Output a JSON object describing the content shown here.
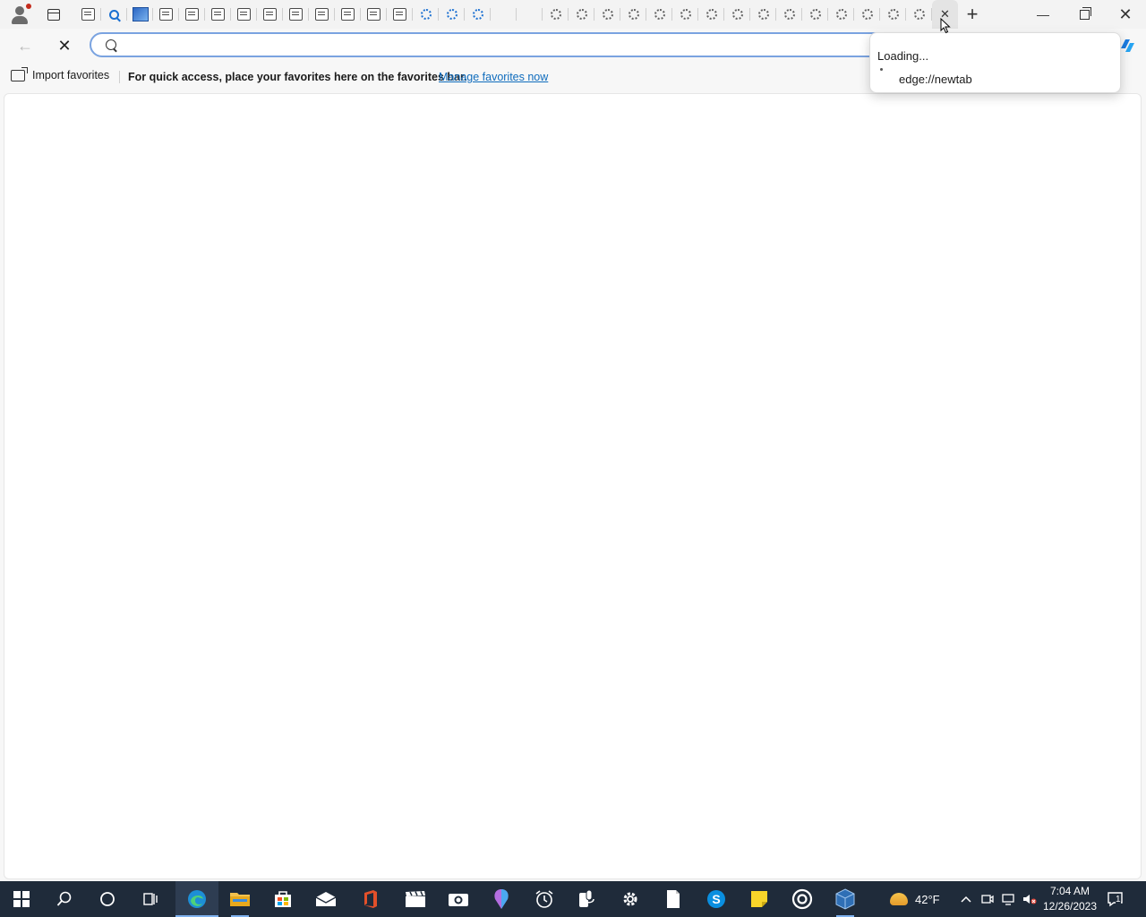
{
  "tabs": {
    "count_visible": 34,
    "active_close_glyph": "✕",
    "favicons": [
      "page",
      "search",
      "image",
      "page",
      "page",
      "page",
      "page",
      "page",
      "page",
      "page",
      "page",
      "page",
      "page",
      "spinner-blue",
      "spinner-blue",
      "spinner-blue",
      "blank",
      "blank",
      "spinner",
      "spinner",
      "spinner",
      "spinner",
      "spinner",
      "spinner",
      "spinner",
      "spinner",
      "spinner",
      "spinner",
      "spinner",
      "spinner",
      "spinner",
      "spinner",
      "spinner",
      "close"
    ]
  },
  "window_controls": {
    "new_tab_glyph": "+",
    "minimize_glyph": "—",
    "close_glyph": "✕"
  },
  "toolbar": {
    "back_glyph": "←",
    "stop_glyph": "✕",
    "address_value": "",
    "address_placeholder": ""
  },
  "favorites_bar": {
    "import_label": "Import favorites",
    "message": "For quick access, place your favorites here on the favorites bar.",
    "manage_link": "Manage favorites now"
  },
  "hover_card": {
    "title": "Loading...",
    "url": "edge://newtab"
  },
  "taskbar": {
    "apps": [
      "start",
      "search",
      "cortana",
      "task-view",
      "edge",
      "file-explorer",
      "store",
      "mail",
      "office",
      "movies",
      "camera",
      "paint-3d",
      "alarms",
      "voice-recorder",
      "settings",
      "notepad",
      "skype",
      "sticky-notes",
      "groove",
      "virtualbox"
    ],
    "weather_temp": "42°F",
    "time": "7:04 AM",
    "date": "12/26/2023",
    "notification_count": "1"
  },
  "colors": {
    "accent": "#0f6cbd",
    "taskbar_bg": "#1f2b3a",
    "address_border": "#7aa3e0"
  }
}
